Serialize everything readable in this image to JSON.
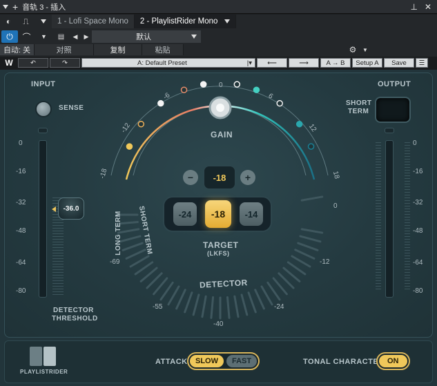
{
  "host": {
    "title": "音轨 3 - 插入",
    "tabs": [
      "1 - Lofi Space Mono",
      "2 - PlaylistRider Mono"
    ],
    "preset_name": "默认",
    "auto_label": "自动: 关",
    "compare_label": "对照",
    "copy_label": "复制",
    "paste_label": "粘贴"
  },
  "waves": {
    "preset": "A: Default Preset",
    "ab": "A → B",
    "setup": "Setup A",
    "save": "Save"
  },
  "plugin": {
    "input_label": "INPUT",
    "output_label": "OUTPUT",
    "sense_label": "SENSE",
    "short_term_label_1": "SHORT",
    "short_term_label_2": "TERM",
    "in_scale": [
      "0",
      "-16",
      "-32",
      "-48",
      "-64",
      "-80"
    ],
    "out_scale": [
      "0",
      "-16",
      "-32",
      "-48",
      "-64",
      "-80"
    ],
    "threshold_value": "-36.0",
    "detector_threshold_1": "DETECTOR",
    "detector_threshold_2": "THRESHOLD",
    "gain_label": "GAIN",
    "gain_ticks": [
      "-18",
      "-12",
      "-6",
      "0",
      "6",
      "12",
      "18"
    ],
    "gain_value": "-18",
    "minus": "−",
    "plus": "+",
    "target_options": [
      "-24",
      "-18",
      "-14"
    ],
    "target_selected": "-18",
    "target_label": "TARGET",
    "target_unit": "(LKFS)",
    "long_term_label": "LONG TERM",
    "short_term_arc_label": "SHORT TERM",
    "detector_label": "DETECTOR",
    "detector_ticks": [
      "0",
      "-12",
      "-24",
      "-40",
      "-55",
      "-69"
    ],
    "attack_label": "ATTACK",
    "attack_slow": "SLOW",
    "attack_fast": "FAST",
    "tonal_label": "TONAL CHARACTER",
    "tonal_value": "ON",
    "logo_text": "PLAYLISTRIDER"
  },
  "colors": {
    "accent_gold": "#f0c85a",
    "accent_teal": "#2bb3b1",
    "host_blue": "#1f73b7"
  }
}
